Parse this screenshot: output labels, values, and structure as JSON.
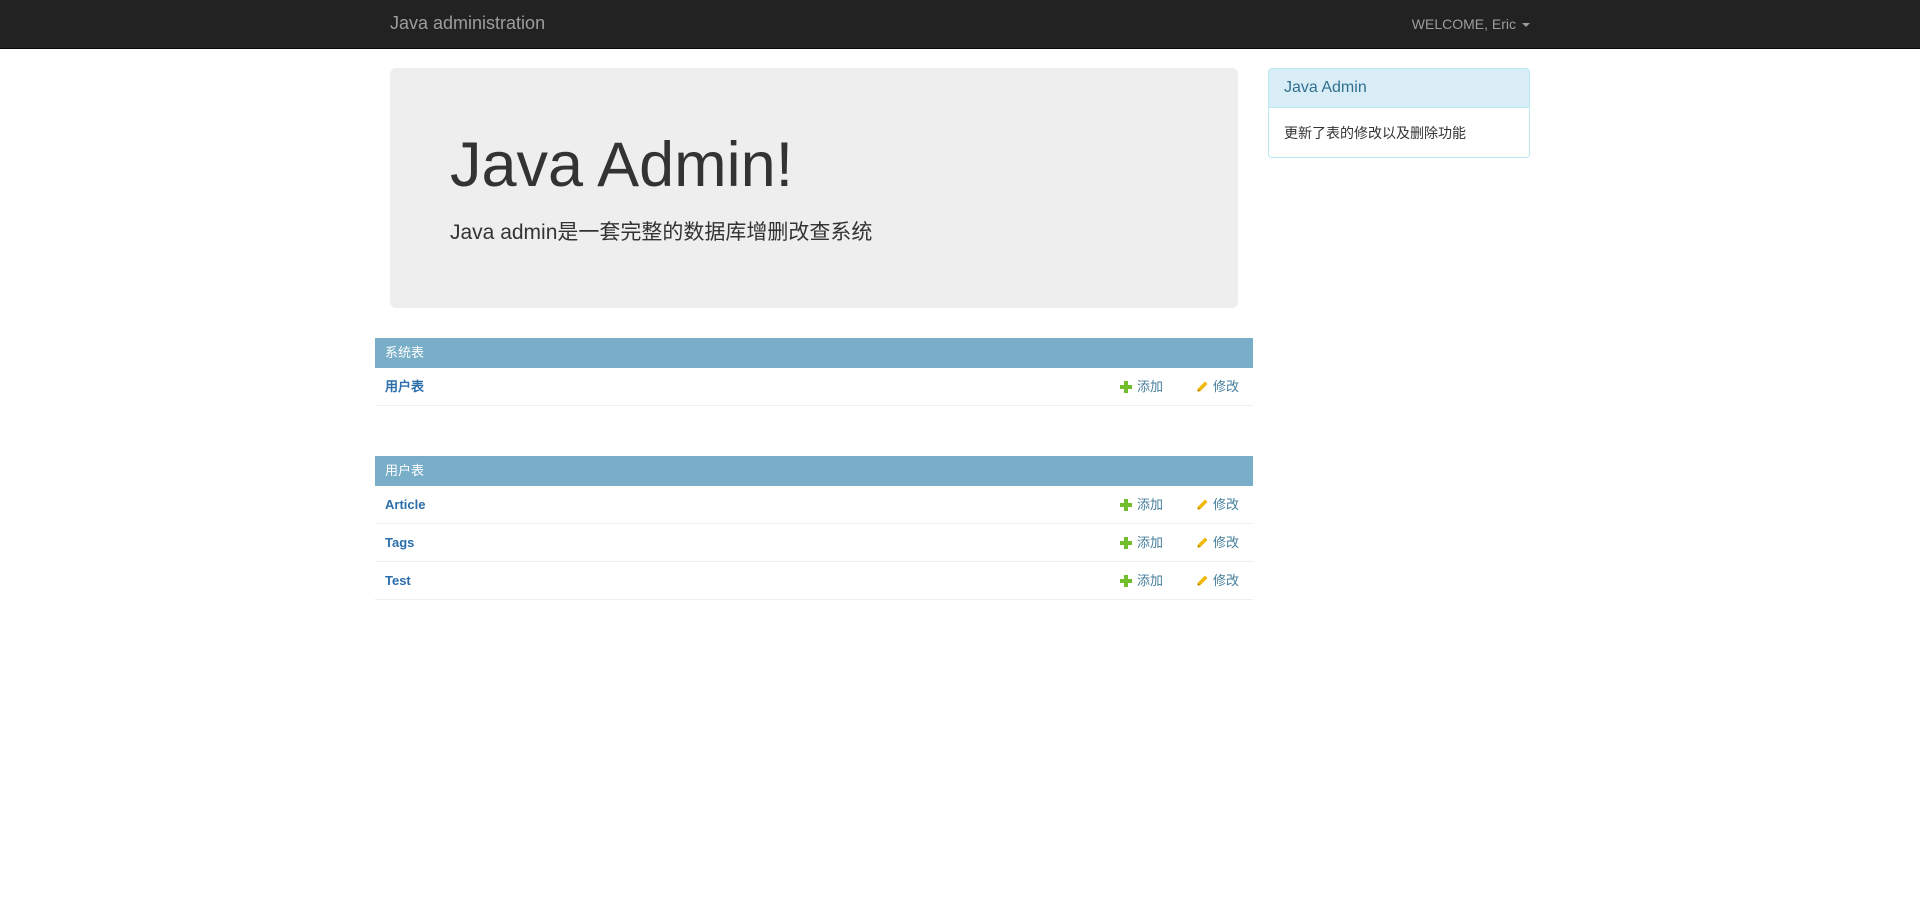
{
  "navbar": {
    "brand": "Java administration",
    "user_menu": "WELCOME, Eric"
  },
  "jumbotron": {
    "title": "Java Admin!",
    "subtitle": "Java admin是一套完整的数据库增删改查系统"
  },
  "info_panel": {
    "heading": "Java Admin",
    "body": "更新了表的修改以及删除功能"
  },
  "modules": [
    {
      "caption": "系统表",
      "rows": [
        {
          "name": "用户表",
          "add_label": "添加",
          "change_label": "修改"
        }
      ]
    },
    {
      "caption": "用户表",
      "rows": [
        {
          "name": "Article",
          "add_label": "添加",
          "change_label": "修改"
        },
        {
          "name": "Tags",
          "add_label": "添加",
          "change_label": "修改"
        },
        {
          "name": "Test",
          "add_label": "添加",
          "change_label": "修改"
        }
      ]
    }
  ],
  "icons": {
    "add": "plus-icon",
    "change": "pencil-icon",
    "user_menu": "caret-down-icon"
  },
  "colors": {
    "navbar_bg": "#222222",
    "module_caption_bg": "#79aec8",
    "link": "#2c6eac",
    "add_icon": "#70bf2b",
    "change_icon": "#efb80b",
    "info_heading_bg": "#d9edf7"
  }
}
